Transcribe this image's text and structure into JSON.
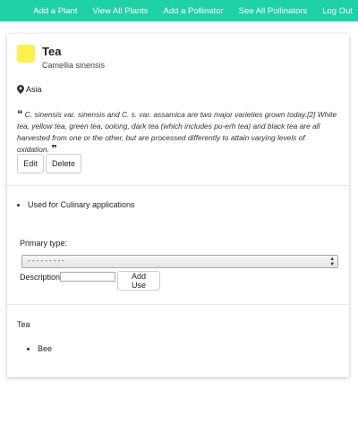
{
  "nav": {
    "add_plant": "Add a Plant",
    "view_plants": "View All Plants",
    "add_pollinator": "Add a Pollinator",
    "see_pollinators": "See All Pollinators",
    "logout": "Log Out"
  },
  "colors": {
    "nav_bg": "#1fd1a6",
    "plant_swatch": "#fff04d"
  },
  "plant": {
    "name": "Tea",
    "scientific_name": "Camellia sinensis",
    "region": "Asia",
    "description": "C. sinensis var. sinensis and C. s. var. assamica are two major varieties grown today.[2] White tea, yellow tea, green tea, oolong, dark tea (which includes pu-erh tea) and black tea are all harvested from one or the other, but are processed differently to attain varying levels of oxidation.",
    "open_quote": "❝",
    "close_quote": "❞"
  },
  "actions": {
    "edit": "Edit",
    "delete": "Delete"
  },
  "uses": {
    "items": [
      "Used for Culinary applications"
    ]
  },
  "use_form": {
    "primary_type_label": "Primary type:",
    "primary_type_value": "---------",
    "description_label": "Description:",
    "description_value": "",
    "add_button": "Add Use"
  },
  "pollinators": {
    "plant_name": "Tea",
    "items": [
      "Bee"
    ]
  }
}
